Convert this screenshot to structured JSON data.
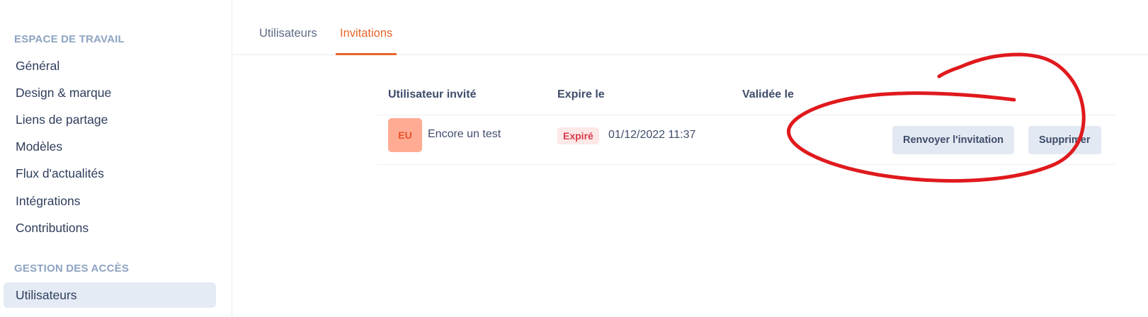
{
  "sidebar": {
    "sections": [
      {
        "title": "ESPACE DE TRAVAIL",
        "items": [
          {
            "label": "Général"
          },
          {
            "label": "Design & marque"
          },
          {
            "label": "Liens de partage"
          },
          {
            "label": "Modèles"
          },
          {
            "label": "Flux d'actualités"
          },
          {
            "label": "Intégrations"
          },
          {
            "label": "Contributions"
          }
        ]
      },
      {
        "title": "GESTION DES ACCÈS",
        "items": [
          {
            "label": "Utilisateurs",
            "active": true
          }
        ]
      }
    ]
  },
  "tabs": [
    {
      "label": "Utilisateurs"
    },
    {
      "label": "Invitations",
      "active": true
    }
  ],
  "table": {
    "headers": [
      "Utilisateur invité",
      "Expire le",
      "Validée le"
    ],
    "rows": [
      {
        "avatar_initials": "EU",
        "name": "Encore un test",
        "status": "Expiré",
        "expire_date": "01/12/2022 11:37",
        "validated": "",
        "actions": {
          "resend": "Renvoyer l'invitation",
          "delete": "Supprimer"
        }
      }
    ]
  },
  "colors": {
    "accent": "#e8652a",
    "annotation": "#e0191d",
    "active_nav_bg": "#e5ebf5",
    "avatar_bg": "#ffab94",
    "badge_bg": "#fde8e8"
  }
}
